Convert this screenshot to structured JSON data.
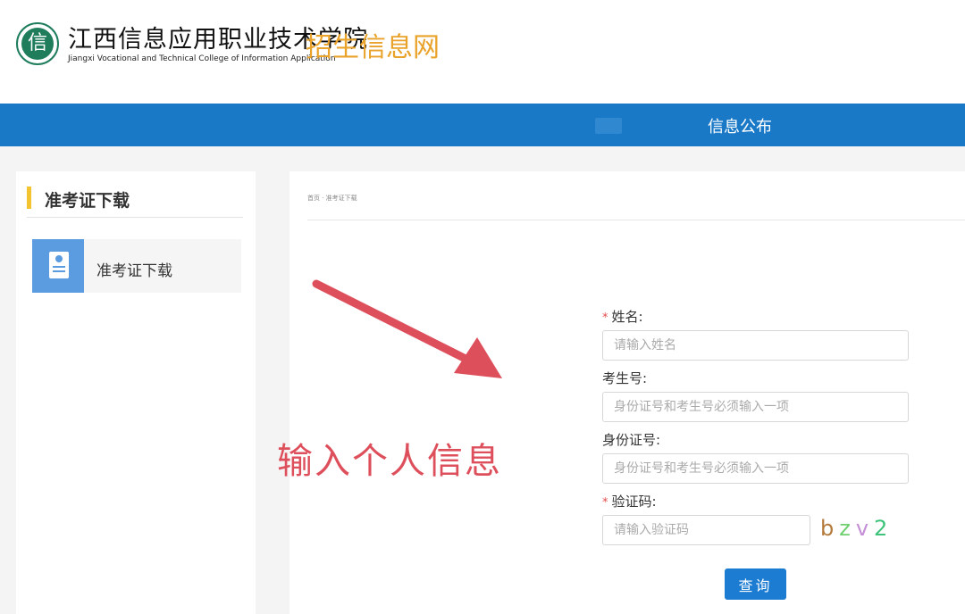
{
  "header": {
    "logo_glyph": "信",
    "college_name": "江西信息应用职业技术学院",
    "college_name_en": "Jiangxi Vocational and Technical College of Information Application",
    "site_name": "招生信息网",
    "brand_color": "#1f7d5c",
    "site_name_color": "#e9a22a"
  },
  "nav": {
    "items": [
      {
        "label": "信息公布"
      }
    ],
    "color": "#1a79c7"
  },
  "sidebar": {
    "title": "准考证下载",
    "accent_color": "#f4c430",
    "items": [
      {
        "label": "准考证下载",
        "icon": "admission-ticket-icon"
      }
    ]
  },
  "main": {
    "breadcrumb": "首页 · 准考证下载",
    "annotation": "输入个人信息",
    "annotation_color": "#de4f5c"
  },
  "form": {
    "name": {
      "label": "姓名:",
      "required": "*",
      "placeholder": "请输入姓名",
      "value": ""
    },
    "exam_no": {
      "label": "考生号:",
      "placeholder": "身份证号和考生号必须输入一项",
      "value": ""
    },
    "id_no": {
      "label": "身份证号:",
      "placeholder": "身份证号和考生号必须输入一项",
      "value": ""
    },
    "captcha": {
      "label": "验证码:",
      "required": "*",
      "placeholder": "请输入验证码",
      "value": "",
      "chars": [
        "b",
        "z",
        "v",
        "2"
      ]
    },
    "submit_label": "查询",
    "button_color": "#1c7cd2"
  }
}
